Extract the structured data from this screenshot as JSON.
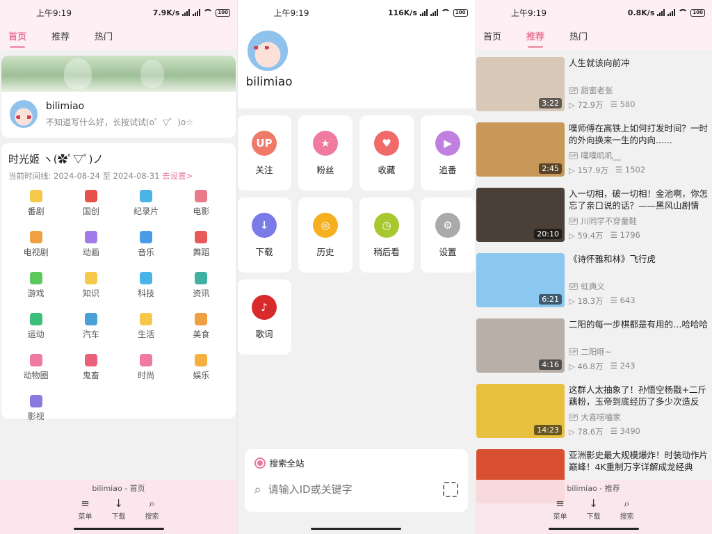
{
  "status": {
    "time": "上午9:19",
    "speeds": [
      "7.9K/s",
      "116K/s",
      "0.8K/s"
    ],
    "battery": "100"
  },
  "screen1": {
    "tabs": [
      "首页",
      "推荐",
      "热门"
    ],
    "profile": {
      "name": "bilimiao",
      "signature": "不知道写什么好，长按试试(o゜▽゜)o☆"
    },
    "timeline": {
      "title": "时光姬 ヽ(✿ﾟ▽ﾟ)ノ",
      "line_prefix": "当前时间线: 2024-08-24 至 2024-08-31",
      "line_link": "去设置>"
    },
    "categories": [
      {
        "label": "番剧",
        "color": "#f5c84a"
      },
      {
        "label": "国创",
        "color": "#e8504a"
      },
      {
        "label": "纪录片",
        "color": "#4ab4e8"
      },
      {
        "label": "电影",
        "color": "#e87a8a"
      },
      {
        "label": "电视剧",
        "color": "#f0a040"
      },
      {
        "label": "动画",
        "color": "#a07ae8"
      },
      {
        "label": "音乐",
        "color": "#4a9ae8"
      },
      {
        "label": "舞蹈",
        "color": "#e85a5a"
      },
      {
        "label": "游戏",
        "color": "#5ac85a"
      },
      {
        "label": "知识",
        "color": "#f5c84a"
      },
      {
        "label": "科技",
        "color": "#4ab4e8"
      },
      {
        "label": "资讯",
        "color": "#40b0a0"
      },
      {
        "label": "运动",
        "color": "#3ac07a"
      },
      {
        "label": "汽车",
        "color": "#4aa0d8"
      },
      {
        "label": "生活",
        "color": "#f5c84a"
      },
      {
        "label": "美食",
        "color": "#f0a040"
      },
      {
        "label": "动物圈",
        "color": "#f07aa0"
      },
      {
        "label": "鬼畜",
        "color": "#e8607a"
      },
      {
        "label": "时尚",
        "color": "#f07aa0"
      },
      {
        "label": "娱乐",
        "color": "#f5b040"
      },
      {
        "label": "影视",
        "color": "#8a7ae0"
      }
    ],
    "bottom": {
      "title": "bilimiao - 首页",
      "buttons": [
        "菜单",
        "下载",
        "搜索"
      ]
    }
  },
  "screen2": {
    "name": "bilimiao",
    "tiles": [
      {
        "label": "关注",
        "color": "#f07a6a",
        "glyph": "UP"
      },
      {
        "label": "粉丝",
        "color": "#f07aa0",
        "glyph": "★"
      },
      {
        "label": "收藏",
        "color": "#f06a6a",
        "glyph": "♥"
      },
      {
        "label": "追番",
        "color": "#c080e0",
        "glyph": "▶"
      },
      {
        "label": "下载",
        "color": "#7a7ae8",
        "glyph": "↓"
      },
      {
        "label": "历史",
        "color": "#f5b020",
        "glyph": "◎"
      },
      {
        "label": "稍后看",
        "color": "#a8c830",
        "glyph": "◷"
      },
      {
        "label": "设置",
        "color": "#aaaaaa",
        "glyph": "⚙"
      },
      {
        "label": "歌词",
        "color": "#d82a2a",
        "glyph": "♪"
      }
    ],
    "search": {
      "title": "搜索全站",
      "placeholder": "请输入ID或关键字"
    }
  },
  "screen3": {
    "tabs": [
      "首页",
      "推荐",
      "热门"
    ],
    "videos": [
      {
        "title": "人生就该向前冲",
        "up": "甜蜜老张",
        "views": "72.9万",
        "danmaku": "580",
        "duration": "3:22",
        "thumb": "#d8c8b8"
      },
      {
        "title": "噗师傅在高铁上如何打发时间？一时的外向换来一生的内向......",
        "up": "噗噗叽叽__",
        "views": "157.9万",
        "danmaku": "1502",
        "duration": "2:45",
        "thumb": "#c89858"
      },
      {
        "title": "入一切相，破一切相！金池啊，你怎忘了亲口说的话？——黑风山剧情详...",
        "up": "川同学不穿童鞋",
        "views": "59.4万",
        "danmaku": "1796",
        "duration": "20:10",
        "thumb": "#4a4038"
      },
      {
        "title": "《诗怀雅和林》飞行虎",
        "up": "虹典义",
        "views": "18.3万",
        "danmaku": "643",
        "duration": "6:21",
        "thumb": "#8ac8f0"
      },
      {
        "title": "二阳的每一步棋都是有用的…哈哈哈",
        "up": "二阳咂~",
        "views": "46.8万",
        "danmaku": "243",
        "duration": "4:16",
        "thumb": "#b8b0a8"
      },
      {
        "title": "这群人太抽象了！孙悟空杨戬+二斤藕粉，玉帝到底经历了多少次造反【用...",
        "up": "大喜唠嗑家",
        "views": "78.6万",
        "danmaku": "3490",
        "duration": "14:23",
        "thumb": "#e8c040"
      },
      {
        "title": "亚洲影史最大规模爆炸！时装动作片巅峰！4K重制万字详解成龙经典《...",
        "up": "",
        "views": "",
        "danmaku": "",
        "duration": "",
        "thumb": "#d85030"
      }
    ],
    "bottom": {
      "title": "bilimiao - 推荐",
      "buttons": [
        "菜单",
        "下载",
        "搜索"
      ]
    }
  }
}
